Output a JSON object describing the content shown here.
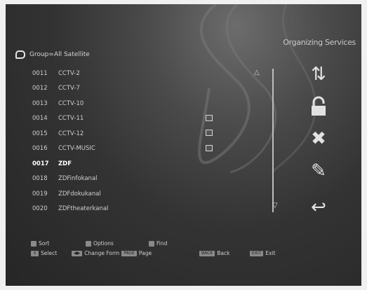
{
  "title": "Organizing Services",
  "group_label": "Group=All Satellite",
  "channels": [
    {
      "num": "0011",
      "name": "CCTV-2",
      "locked": false,
      "selected": false
    },
    {
      "num": "0012",
      "name": "CCTV-7",
      "locked": false,
      "selected": false
    },
    {
      "num": "0013",
      "name": "CCTV-10",
      "locked": false,
      "selected": false
    },
    {
      "num": "0014",
      "name": "CCTV-11",
      "locked": true,
      "selected": false
    },
    {
      "num": "0015",
      "name": "CCTV-12",
      "locked": true,
      "selected": false
    },
    {
      "num": "0016",
      "name": "CCTV-MUSIC",
      "locked": true,
      "selected": false
    },
    {
      "num": "0017",
      "name": "ZDF",
      "locked": false,
      "selected": true
    },
    {
      "num": "0018",
      "name": "ZDFinfokanal",
      "locked": false,
      "selected": false
    },
    {
      "num": "0019",
      "name": "ZDFdokukanal",
      "locked": false,
      "selected": false
    },
    {
      "num": "0020",
      "name": "ZDFtheaterkanal",
      "locked": false,
      "selected": false
    }
  ],
  "side_icons": [
    "move-icon",
    "lock-icon",
    "delete-icon",
    "edit-icon",
    "return-icon"
  ],
  "legend": {
    "sort": "Sort",
    "options": "Options",
    "find": "Find",
    "select": "Select",
    "change_form": "Change Form",
    "page": "Page",
    "back": "Back",
    "exit": "Exit",
    "key_page": "PAGE",
    "key_back": "BACK",
    "key_exit": "EXIT"
  }
}
